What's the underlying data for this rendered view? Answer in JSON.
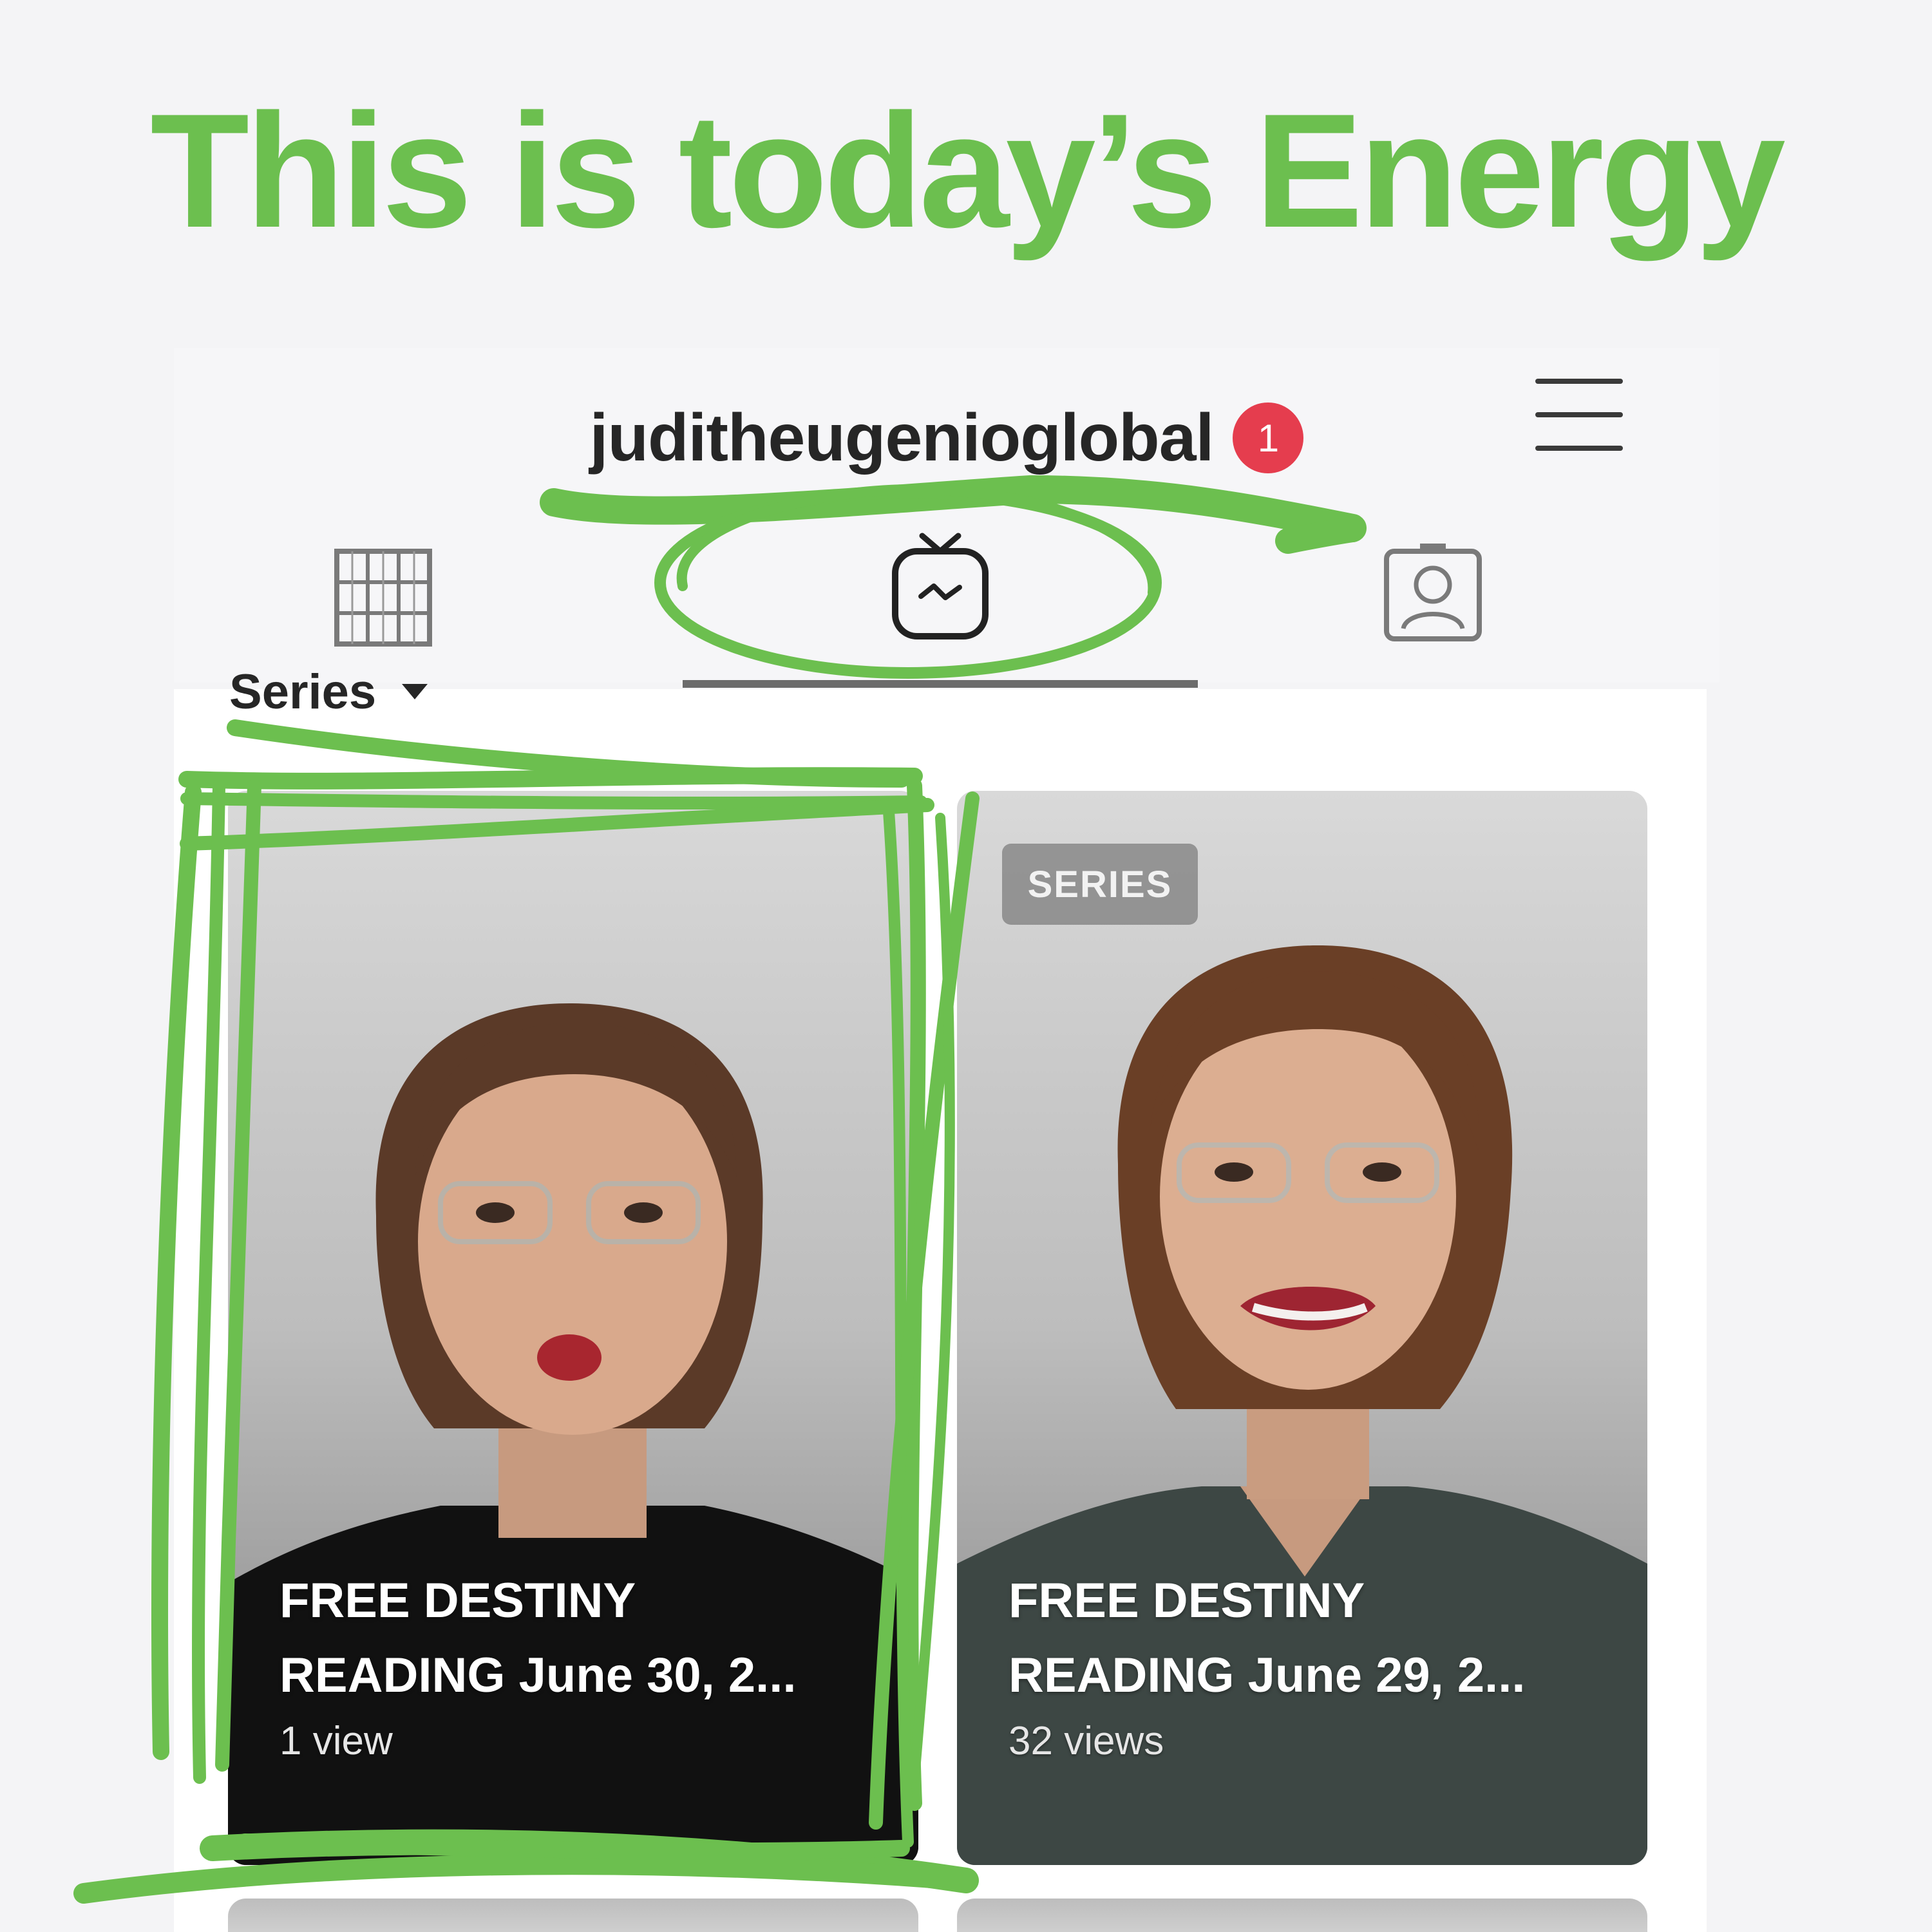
{
  "headline": "This is today’s Energy",
  "header": {
    "username": "juditheugenioglobal",
    "notification_count": "1"
  },
  "tabs": [
    {
      "name": "posts-grid",
      "icon": "grid-icon",
      "active": false
    },
    {
      "name": "igtv",
      "icon": "igtv-icon",
      "active": true
    },
    {
      "name": "tagged",
      "icon": "tagged-person-icon",
      "active": false
    }
  ],
  "feed": {
    "filter_label": "Series",
    "videos": [
      {
        "title": "FREE DESTINY\nREADING June 30, 2...",
        "views": "1 view",
        "tag": ""
      },
      {
        "title": "FREE DESTINY\nREADING June 29, 2...",
        "views": "32 views",
        "tag": "SERIES"
      }
    ]
  },
  "colors": {
    "annotation_green": "#6cbf4f",
    "badge_red": "#e53d4e",
    "text_dark": "#262626"
  }
}
